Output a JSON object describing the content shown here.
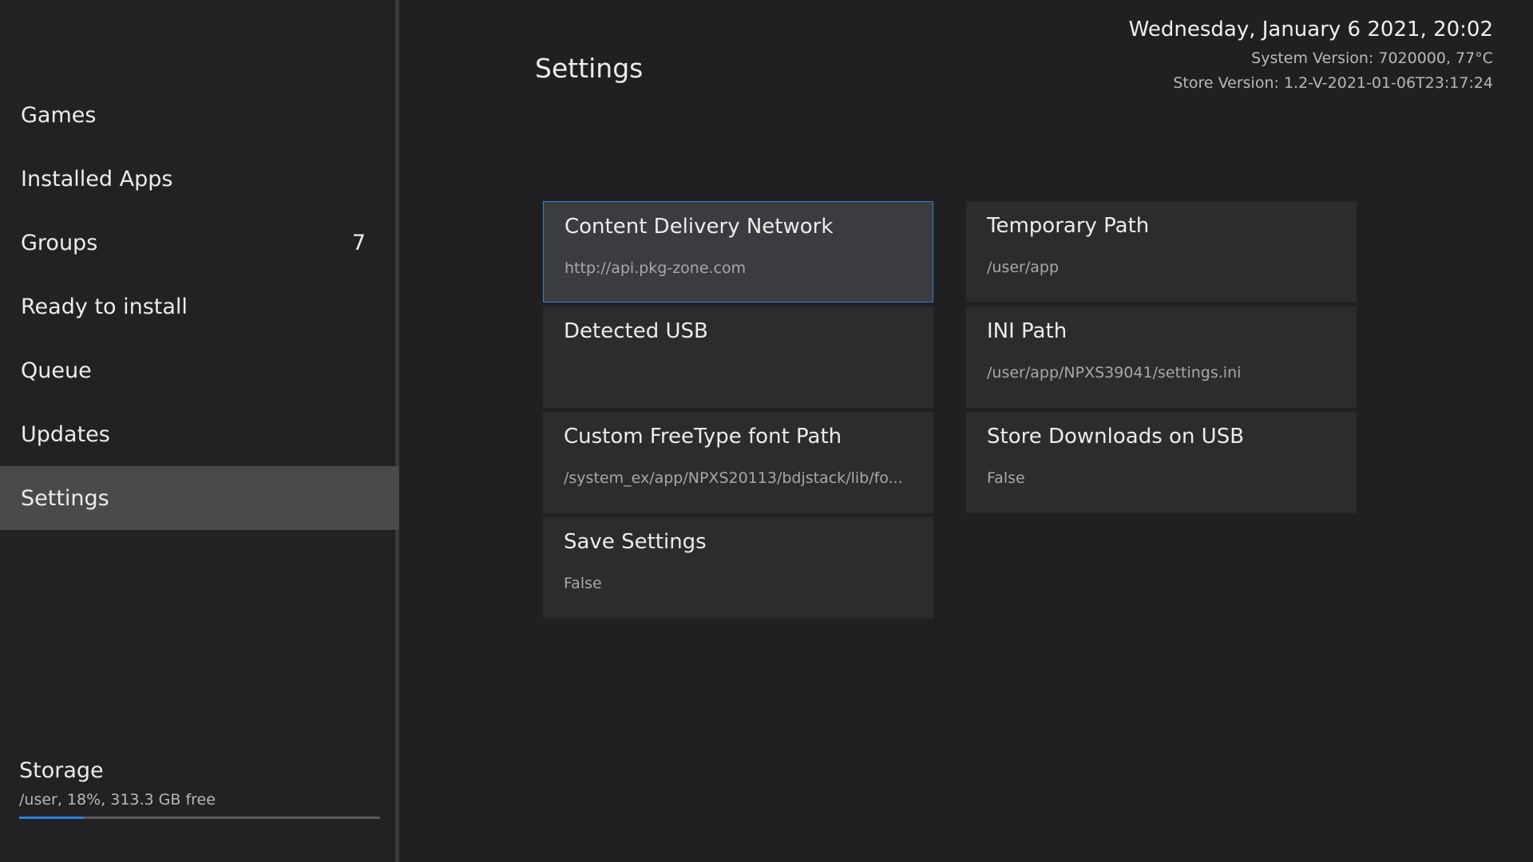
{
  "sidebar": {
    "items": [
      {
        "label": "Games",
        "count": ""
      },
      {
        "label": "Installed Apps",
        "count": ""
      },
      {
        "label": "Groups",
        "count": "7"
      },
      {
        "label": "Ready to install",
        "count": ""
      },
      {
        "label": "Queue",
        "count": ""
      },
      {
        "label": "Updates",
        "count": ""
      },
      {
        "label": "Settings",
        "count": ""
      }
    ],
    "active": "Settings",
    "storage": {
      "title": "Storage",
      "info": "/user,  18%, 313.3 GB free",
      "used_fraction": 0.18,
      "bar_color": "#2f7fe0"
    }
  },
  "header": {
    "title": "Settings",
    "datetime": "Wednesday, January  6 2021, 20:02",
    "system_version": "System Version: 7020000, 77°C",
    "store_version": "Store Version: 1.2-V-2021-01-06T23:17:24"
  },
  "settings": [
    {
      "title": "Content Delivery Network",
      "value": "http://api.pkg-zone.com",
      "selected": true
    },
    {
      "title": "Temporary Path",
      "value": "/user/app",
      "selected": false
    },
    {
      "title": "Detected USB",
      "value": "",
      "selected": false
    },
    {
      "title": "INI Path",
      "value": "/user/app/NPXS39041/settings.ini",
      "selected": false
    },
    {
      "title": "Custom FreeType font Path",
      "value": "/system_ex/app/NPXS20113/bdjstack/lib/fo...",
      "selected": false
    },
    {
      "title": "Store Downloads on USB",
      "value": "False",
      "selected": false
    },
    {
      "title": "Save Settings",
      "value": "False",
      "selected": false
    }
  ],
  "colors": {
    "background": "#202022",
    "accent": "#3e7ad6",
    "active_nav": "#4a4a4c"
  }
}
